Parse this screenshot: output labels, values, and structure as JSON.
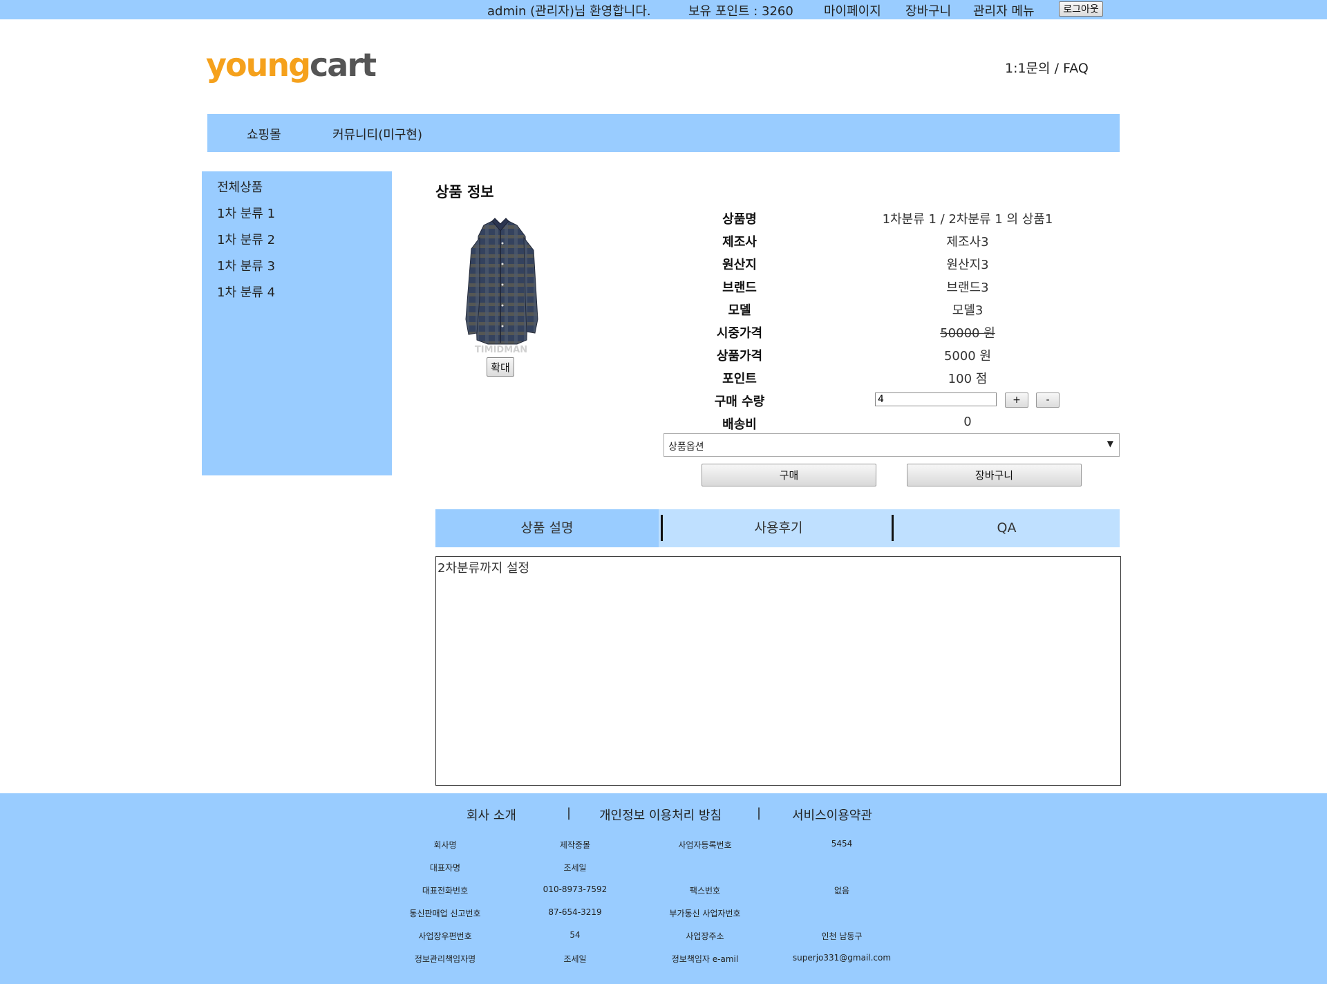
{
  "topbar": {
    "welcome": "admin (관리자)님 환영합니다.",
    "points": "보유 포인트 : 3260",
    "mypage": "마이페이지",
    "cart": "장바구니",
    "admin_menu": "관리자 메뉴",
    "logout": "로그아웃"
  },
  "header": {
    "logo_part1": "young",
    "logo_part2": "cart",
    "help_link": "1:1문의 / FAQ",
    "logo_colors": {
      "young": "#f5a11c",
      "cart": "#555555"
    }
  },
  "nav": {
    "items": [
      "쇼핑몰",
      "커뮤니티(미구현)"
    ]
  },
  "sidebar": {
    "items": [
      "전체상품",
      "1차 분류 1",
      "1차 분류 2",
      "1차 분류 3",
      "1차 분류 4"
    ]
  },
  "product": {
    "section_title": "상품 정보",
    "image_watermark": "TIMIDMAN",
    "zoom_label": "확대",
    "specs": [
      {
        "label": "상품명",
        "value": "1차분류 1 / 2차분류 1 의 상품1"
      },
      {
        "label": "제조사",
        "value": "제조사3"
      },
      {
        "label": "원산지",
        "value": "원산지3"
      },
      {
        "label": "브랜드",
        "value": "브랜드3"
      },
      {
        "label": "모델",
        "value": "모델3"
      },
      {
        "label": "시중가격",
        "value": "50000 원"
      },
      {
        "label": "상품가격",
        "value": "5000 원"
      },
      {
        "label": "포인트",
        "value": "100 점"
      },
      {
        "label": "구매 수량",
        "value": ""
      },
      {
        "label": "배송비",
        "value": "0"
      }
    ],
    "quantity": "4",
    "plus": "+",
    "minus": "-",
    "option_selected": "상품옵션",
    "buy_label": "구매",
    "cart_label": "장바구니"
  },
  "tabs": {
    "items": [
      "상품 설명",
      "사용후기",
      "QA"
    ],
    "active": "상품 설명"
  },
  "description": {
    "text": "2차분류까지 설정"
  },
  "footer": {
    "links": [
      "회사 소개",
      "개인정보 이용처리 방침",
      "서비스이용약관"
    ],
    "separator": "|",
    "rows": [
      [
        "회사명",
        "제작중몰",
        "사업자등록번호",
        "5454"
      ],
      [
        "대표자명",
        "조세일",
        "",
        ""
      ],
      [
        "대표전화번호",
        "010-8973-7592",
        "팩스번호",
        "없음"
      ],
      [
        "통신판매업 신고번호",
        "87-654-3219",
        "부가통신 사업자번호",
        ""
      ],
      [
        "사업장우편번호",
        "54",
        "사업장주소",
        "인천 남동구"
      ],
      [
        "정보관리책임자명",
        "조세일",
        "정보책임자 e-amil",
        "superjo331@gmail.com"
      ]
    ]
  },
  "colors": {
    "bar_blue": "#99ccff",
    "tab_light": "#bfe0ff"
  }
}
